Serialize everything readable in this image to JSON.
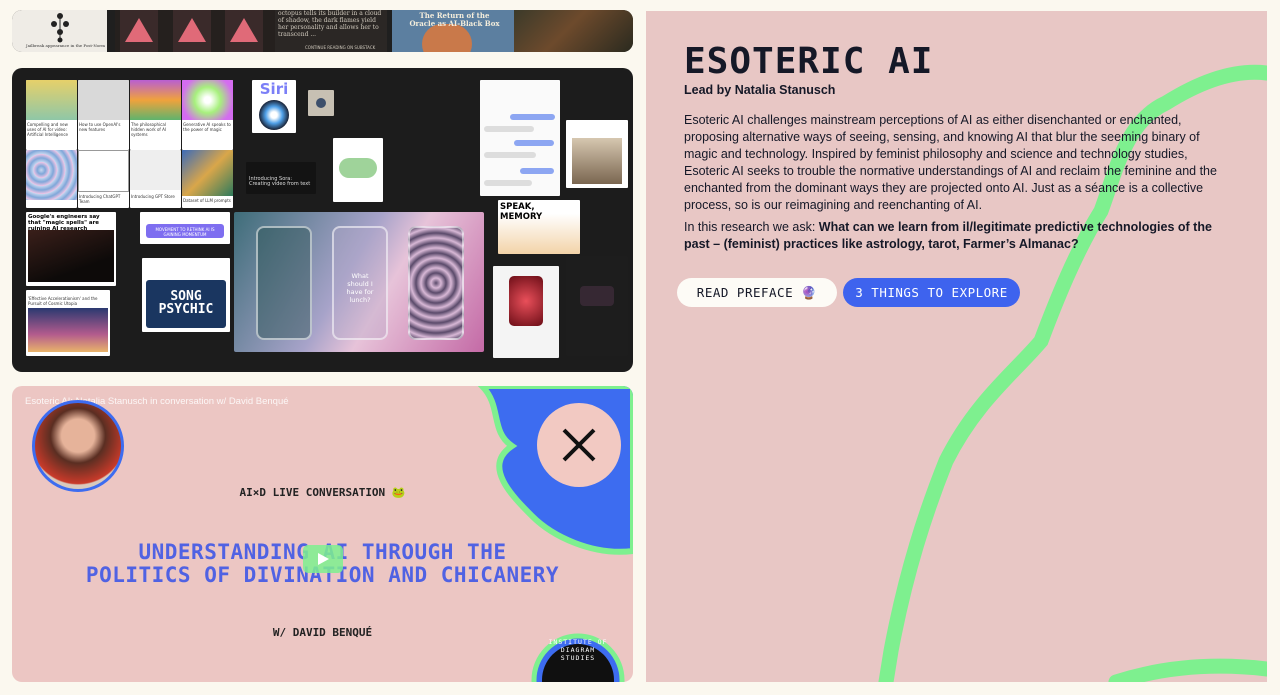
{
  "strip": {
    "thumb1_caption": "Jailbreak appearance in the Post-Norm",
    "thumb2_text": "octopus tells its builder in a cloud of shadow, the dark flames yield her personality and allows her to transcend ...",
    "thumb2_footer": "CONTINUE READING ON SUBSTACK",
    "thumb3_title": "The Return of the Oracle as AI-Black Box"
  },
  "collage": {
    "siri_label": "Siri",
    "sora_label": "Introducing Sora: Creating video from text",
    "speak_memory": "SPEAK, MEMORY",
    "song_psychic": "SONG PSYCHIC",
    "phone_question": "What should I have for lunch?",
    "headline_1": "Google's engineers say that \"magic spells\" are ruining AI research",
    "headline_2": "'Effective Accelerationism' and the Pursuit of Cosmic Utopia",
    "card_caption_1": "Compelling and new uses of AI for video: Artificial Intelligence",
    "card_caption_2": "How to use OpenAI's new features",
    "card_caption_3": "The philosophical hidden work of AI systems",
    "card_caption_4": "Generative AI speaks to the power of magic",
    "card_caption_5": "Introducing ChatGPT Team",
    "card_caption_6": "Introducing GPT Store",
    "card_caption_7": "Dataset of LLM prompts",
    "badge_text": "MOVEMENT TO RETHINK AI IS GAINING MOMENTUM"
  },
  "video": {
    "caption": "Esoteric AI: Natalia Stanusch in conversation w/ David Benqué",
    "kicker": "AI×D LIVE CONVERSATION 🐸",
    "headline_line1": "UNDERSTANDING AI THROUGH THE",
    "headline_line2": "POLITICS OF DIVINATION AND CHICANERY",
    "with": "W/ DAVID BENQUÉ",
    "seal_text": "INSTITUTE OF DIAGRAM STUDIES",
    "colors": {
      "headline": "#5062e3",
      "blob": "#3d6cf0",
      "accent_green": "#7ef08f",
      "pink": "#ecc6c3"
    }
  },
  "right": {
    "title": "ESOTERIC AI",
    "lead": "Lead by Natalia Stanusch",
    "description": "Esoteric AI challenges mainstream perceptions of AI as either disenchanted or enchanted, proposing alternative ways of seeing, sensing, and knowing AI that blur the seeming binary of magic and technology. Inspired by feminist philosophy and science and technology studies, Esoteric AI seeks to trouble the normative understandings of AI and reclaim the feminine and the enchanted from the dominant ways they are projected onto AI. Just as a séance is a collective process, so is our reimagining and reenchanting of AI.",
    "ask_intro": "In this research we ask: ",
    "ask_question": "What can we learn from il/legitimate predictive technologies of the past – (feminist) practices like astrology, tarot, Farmer’s Almanac?",
    "read_preface": "READ PREFACE 🔮",
    "things_to_explore": "3 THINGS TO EXPLORE",
    "colors": {
      "background": "#e8c7c5",
      "button_blue": "#3e63ee",
      "squiggle": "#7ef08f",
      "text": "#151827"
    }
  }
}
